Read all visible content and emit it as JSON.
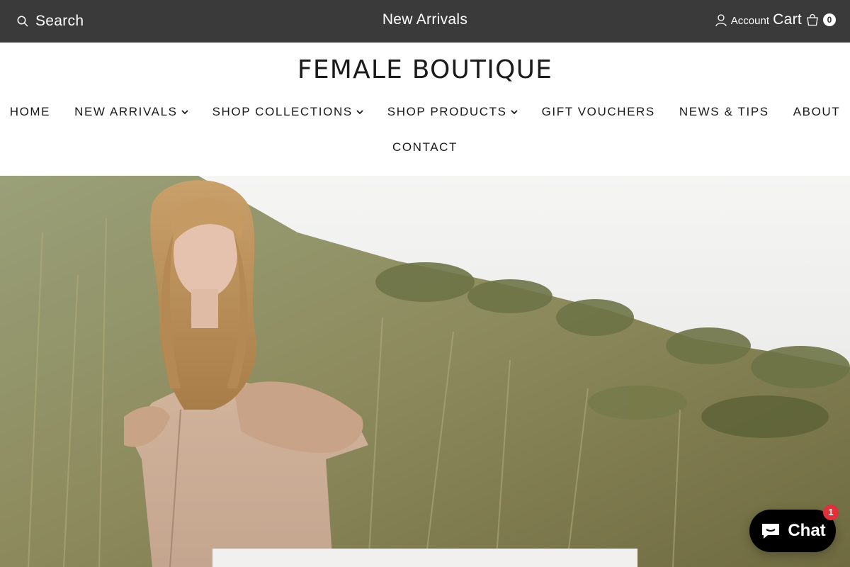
{
  "topbar": {
    "search_label": "Search",
    "announcement": "New Arrivals",
    "account_label": "Account",
    "cart_label": "Cart",
    "cart_count": "0",
    "background": "#3a3a3a"
  },
  "brand": {
    "logo_text": "FEMALE BOUTIQUE"
  },
  "nav": {
    "row1": [
      {
        "label": "HOME",
        "has_dropdown": false
      },
      {
        "label": "NEW ARRIVALS",
        "has_dropdown": true
      },
      {
        "label": "SHOP COLLECTIONS",
        "has_dropdown": true
      },
      {
        "label": "SHOP PRODUCTS",
        "has_dropdown": true
      },
      {
        "label": "GIFT VOUCHERS",
        "has_dropdown": false
      },
      {
        "label": "NEWS & TIPS",
        "has_dropdown": false
      },
      {
        "label": "ABOUT",
        "has_dropdown": false
      }
    ],
    "row2": [
      {
        "label": "CONTACT",
        "has_dropdown": false
      }
    ]
  },
  "chat": {
    "label": "Chat",
    "badge_count": "1",
    "badge_color": "#e0313a"
  },
  "icons": {
    "search": "search-icon",
    "account": "user-icon",
    "cart": "shopping-bag-icon",
    "dropdown": "chevron-down-icon",
    "chat": "chat-bubble-icon"
  }
}
